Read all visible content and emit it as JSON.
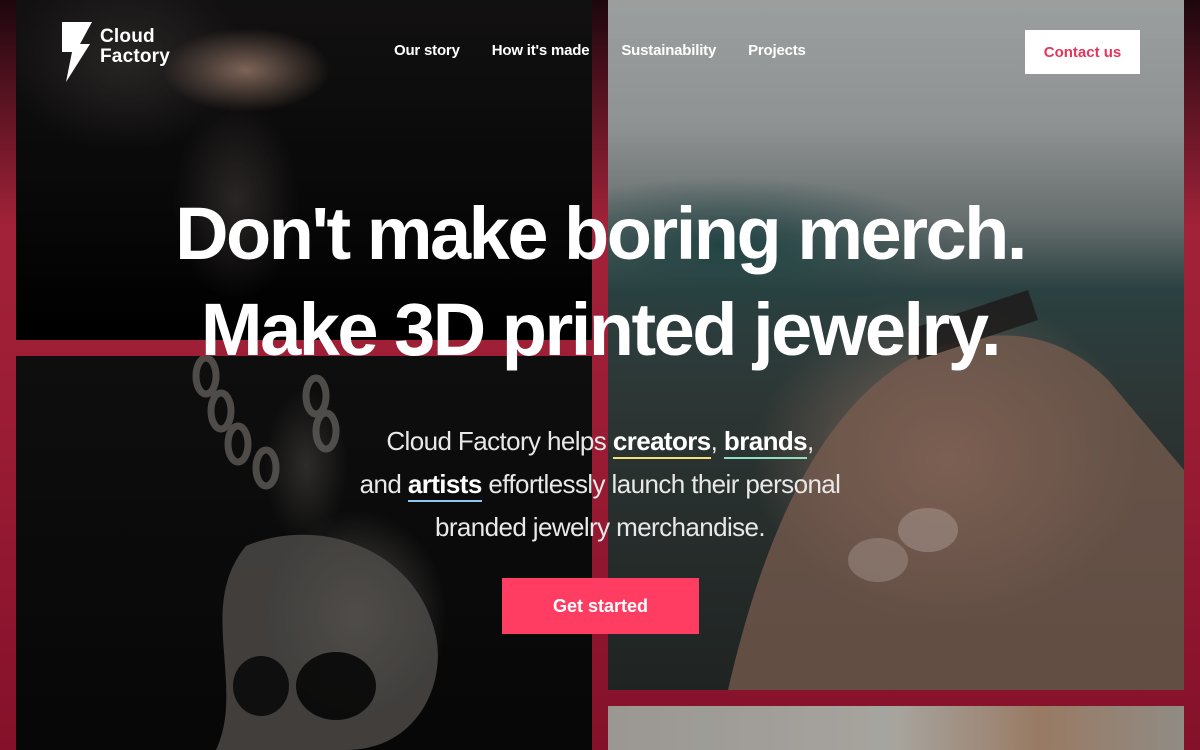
{
  "brand": {
    "line1": "Cloud",
    "line2": "Factory",
    "logo_icon": "lightning-bolt-icon"
  },
  "nav": {
    "items": [
      {
        "label": "Our story"
      },
      {
        "label": "How it's made"
      },
      {
        "label": "Sustainability"
      },
      {
        "label": "Projects"
      }
    ],
    "contact_label": "Contact us"
  },
  "hero": {
    "headline_line1": "Don't make boring merch.",
    "headline_line2": "Make 3D printed jewelry.",
    "sub_part1": "Cloud Factory helps ",
    "sub_creators": "creators",
    "sub_comma1": ", ",
    "sub_brands": "brands",
    "sub_part2": ",",
    "sub_part3": " and ",
    "sub_artists": "artists",
    "sub_part4": " effortlessly launch their personal branded jewelry merchandise.",
    "cta_label": "Get started"
  },
  "colors": {
    "accent": "#ff3d63",
    "contact_text": "#e8335a",
    "underline_creators": "#f3e27a",
    "underline_brands": "#8fe0c0",
    "underline_artists": "#8cc8f2"
  }
}
